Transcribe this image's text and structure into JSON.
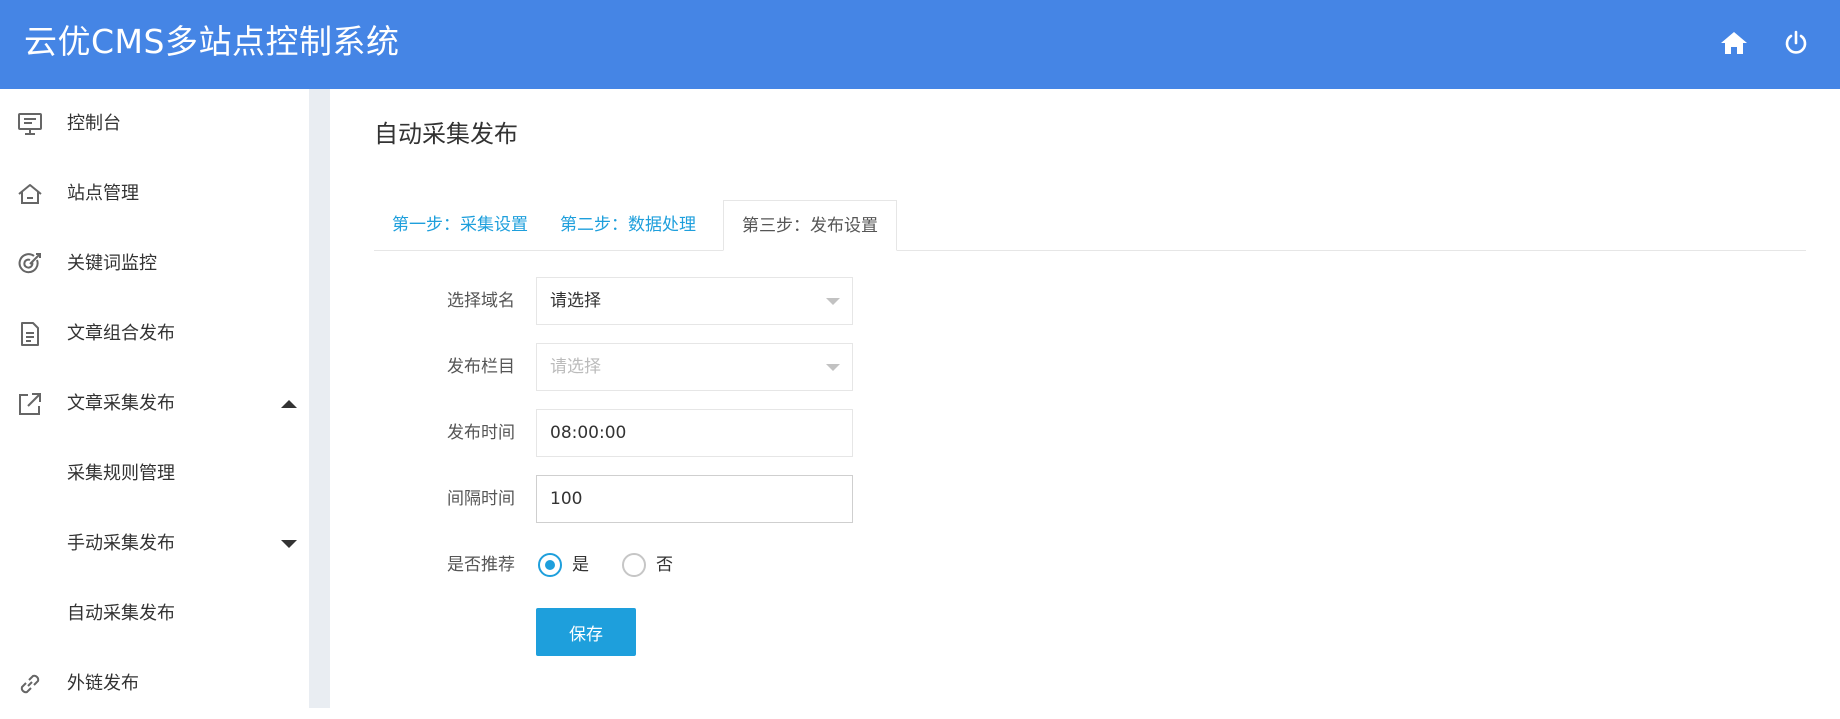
{
  "header": {
    "title": "云优CMS多站点控制系统",
    "home_icon": "home-icon",
    "power_icon": "power-icon"
  },
  "sidebar": {
    "items": [
      {
        "label": "控制台",
        "icon": "monitor-icon"
      },
      {
        "label": "站点管理",
        "icon": "house-icon"
      },
      {
        "label": "关键词监控",
        "icon": "target-icon"
      },
      {
        "label": "文章组合发布",
        "icon": "document-icon"
      },
      {
        "label": "文章采集发布",
        "icon": "external-link-icon",
        "expanded": true
      },
      {
        "label": "采集规则管理"
      },
      {
        "label": "手动采集发布",
        "expanded": false
      },
      {
        "label": "自动采集发布"
      },
      {
        "label": "外链发布",
        "icon": "link-icon"
      }
    ]
  },
  "main": {
    "title": "自动采集发布",
    "tabs": [
      {
        "label": "第一步：采集设置"
      },
      {
        "label": "第二步：数据处理"
      },
      {
        "label": "第三步：发布设置",
        "active": true
      }
    ],
    "form": {
      "domain_label": "选择域名",
      "domain_value": "请选择",
      "column_label": "发布栏目",
      "column_placeholder": "请选择",
      "time_label": "发布时间",
      "time_value": "08:00:00",
      "interval_label": "间隔时间",
      "interval_value": "100",
      "recommend_label": "是否推荐",
      "recommend_yes": "是",
      "recommend_no": "否",
      "recommend_selected": "是",
      "save_label": "保存"
    }
  },
  "colors": {
    "header_bg": "#4585e5",
    "accent": "#1e9fdc",
    "gutter": "#e9edf2"
  }
}
